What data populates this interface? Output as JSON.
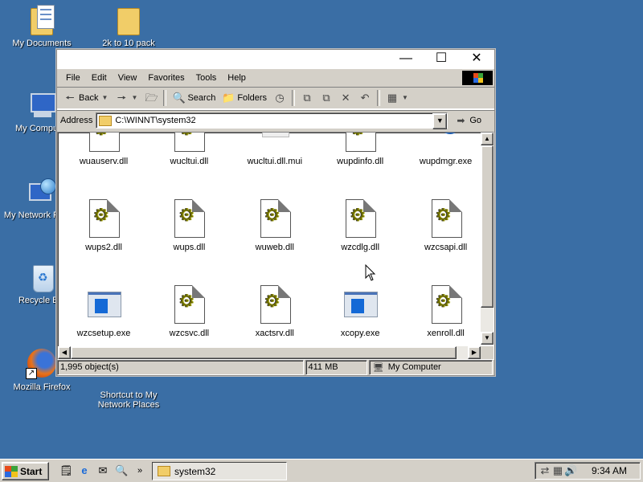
{
  "desktop": {
    "icons": [
      {
        "label": "My Documents"
      },
      {
        "label": "2k to 10 pack"
      },
      {
        "label": "My Computer"
      },
      {
        "label": "My Network Places"
      },
      {
        "label": "Recycle Bin"
      },
      {
        "label": "Mozilla Firefox"
      },
      {
        "label": "Shortcut to My Network Places"
      }
    ]
  },
  "window": {
    "menu": [
      "File",
      "Edit",
      "View",
      "Favorites",
      "Tools",
      "Help"
    ],
    "toolbar": {
      "back": "Back",
      "search": "Search",
      "folders": "Folders"
    },
    "address": {
      "label": "Address",
      "value": "C:\\WINNT\\system32",
      "go": "Go"
    },
    "files": [
      {
        "name": "wuauserv.dll",
        "type": "dll"
      },
      {
        "name": "wucltui.dll",
        "type": "dll"
      },
      {
        "name": "wucltui.dll.mui",
        "type": "blank"
      },
      {
        "name": "wupdinfo.dll",
        "type": "dll"
      },
      {
        "name": "wupdmgr.exe",
        "type": "wupd"
      },
      {
        "name": "wups2.dll",
        "type": "dll"
      },
      {
        "name": "wups.dll",
        "type": "dll"
      },
      {
        "name": "wuweb.dll",
        "type": "dll"
      },
      {
        "name": "wzcdlg.dll",
        "type": "dll"
      },
      {
        "name": "wzcsapi.dll",
        "type": "dll"
      },
      {
        "name": "wzcsetup.exe",
        "type": "exe"
      },
      {
        "name": "wzcsvc.dll",
        "type": "dll"
      },
      {
        "name": "xactsrv.dll",
        "type": "dll"
      },
      {
        "name": "xcopy.exe",
        "type": "exe"
      },
      {
        "name": "xenroll.dll",
        "type": "dll"
      }
    ],
    "status": {
      "count": "1,995 object(s)",
      "size": "411 MB",
      "zone": "My Computer"
    }
  },
  "taskbar": {
    "start": "Start",
    "task": "system32",
    "clock": "9:34 AM"
  }
}
